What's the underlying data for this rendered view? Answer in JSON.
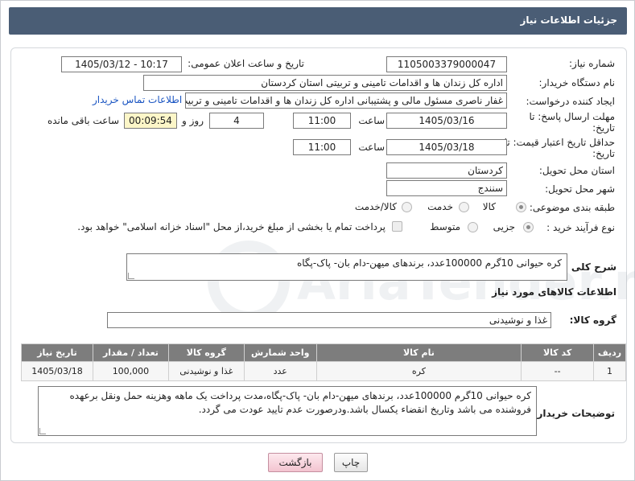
{
  "header": {
    "title": "جزئیات اطلاعات نیاز"
  },
  "fields": {
    "need_number_label": "شماره نیاز:",
    "need_number": "1105003379000047",
    "announce_label": "تاریخ و ساعت اعلان عمومی:",
    "announce_value": "1405/03/12 - 10:17",
    "buyer_org_label": "نام دستگاه خریدار:",
    "buyer_org": "اداره کل زندان ها و اقدامات تامینی و تربیتی استان کردستان",
    "creator_label": "ایجاد کننده درخواست:",
    "creator": "غفار ناصری مسئول مالی و پشتیبانی اداره کل زندان ها و اقدامات تامینی و تربیت",
    "contact_link": "اطلاعات تماس خریدار",
    "deadline_label": "مهلت ارسال پاسخ: تا تاریخ:",
    "deadline_date": "1405/03/16",
    "time_label": "ساعت",
    "deadline_time": "11:00",
    "days_count": "4",
    "days_label": "روز و",
    "remaining_time": "00:09:54",
    "remaining_label": "ساعت باقی مانده",
    "validity_label": "حداقل تاریخ اعتبار قیمت: تا تاریخ:",
    "validity_date": "1405/03/18",
    "validity_time": "11:00",
    "province_label": "استان محل تحویل:",
    "province": "کردستان",
    "city_label": "شهر محل تحویل:",
    "city": "سنندج",
    "category_label": "طبقه بندی موضوعی:",
    "category_options": [
      "کالا",
      "خدمت",
      "کالا/خدمت"
    ],
    "process_label": "نوع فرآیند خرید :",
    "process_options": [
      "جزیی",
      "متوسط"
    ],
    "payment_note": "پرداخت تمام یا بخشی از مبلغ خرید،از محل \"اسناد خزانه اسلامی\" خواهد بود.",
    "summary_label": "شرح کلی نیاز:",
    "summary": "کره حیوانی 10گرم 100000عدد، برندهای میهن-دام بان- پاک-پگاه",
    "goods_info_title": "اطلاعات کالاهای مورد نیاز",
    "goods_group_label": "گروه کالا:",
    "goods_group": "غذا و نوشیدنی",
    "buyer_notes_label": "توضیحات خریدار:",
    "buyer_notes": "کره حیوانی 10گرم 100000عدد، برندهای میهن-دام بان- پاک-پگاه،مدت پرداخت یک ماهه وهزینه حمل ونقل برعهده فروشنده می باشد وتاریخ انقضاء یکسال باشد.ودرصورت عدم تایید عودت می گردد."
  },
  "table": {
    "headers": [
      "ردیف",
      "کد کالا",
      "نام کالا",
      "واحد شمارش",
      "گروه کالا",
      "تعداد / مقدار",
      "تاریخ نیاز"
    ],
    "rows": [
      [
        "1",
        "--",
        "کره",
        "عدد",
        "غذا و نوشیدنی",
        "100,000",
        "1405/03/18"
      ]
    ]
  },
  "buttons": {
    "print": "چاپ",
    "back": "بازگشت"
  },
  "watermark_text": "AriaTender.net",
  "colors": {
    "header_bg": "#4a5d75",
    "table_header_bg": "#7d7d7d",
    "link": "#1a55c2",
    "remaining_bg": "#fcf6c8"
  }
}
